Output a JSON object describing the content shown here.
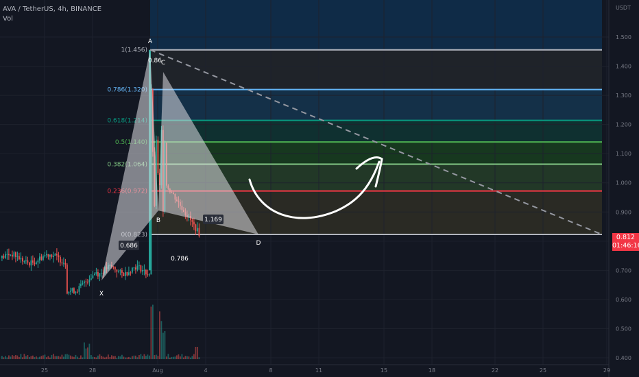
{
  "header": {
    "symbol_line": "AVA / TetherUS, 4h, BINANCE",
    "volume_label": "Vol"
  },
  "price_tag": {
    "price": "0.812",
    "countdown": "01:46:16"
  },
  "chart_data": {
    "type": "candlestick",
    "price_axis_unit": "USDT",
    "y_ticks": [
      "1.500",
      "1.400",
      "1.300",
      "1.200",
      "1.100",
      "1.000",
      "0.900",
      "0.800",
      "0.700",
      "0.600",
      "0.500",
      "0.400"
    ],
    "x_ticks": [
      "25",
      "28",
      "Aug",
      "4",
      "8",
      "11",
      "15",
      "18",
      "22",
      "25",
      "29"
    ],
    "fib_levels": [
      {
        "label": "1(1.456)",
        "value": 1.456,
        "color": "#b2b5be"
      },
      {
        "label": "0.786(1.320)",
        "value": 1.32,
        "color": "#64b5f6"
      },
      {
        "label": "0.618(1.214)",
        "value": 1.214,
        "color": "#089981"
      },
      {
        "label": "0.5(1.140)",
        "value": 1.14,
        "color": "#4caf50"
      },
      {
        "label": "0.382(1.064)",
        "value": 1.064,
        "color": "#81c784"
      },
      {
        "label": "0.236(0.972)",
        "value": 0.972,
        "color": "#f23645"
      },
      {
        "label": "0(0.823)",
        "value": 0.823,
        "color": "#b2b5be"
      }
    ],
    "pattern_points": [
      {
        "label": "X",
        "price": 0.665
      },
      {
        "label": "A",
        "price": 1.456
      },
      {
        "label": "B",
        "price": 0.905
      },
      {
        "label": "C",
        "price": 1.38
      },
      {
        "label": "D",
        "price": 0.823
      }
    ],
    "pattern_ratios": [
      "0.686",
      "0.86",
      "0.786",
      "1.169"
    ]
  }
}
